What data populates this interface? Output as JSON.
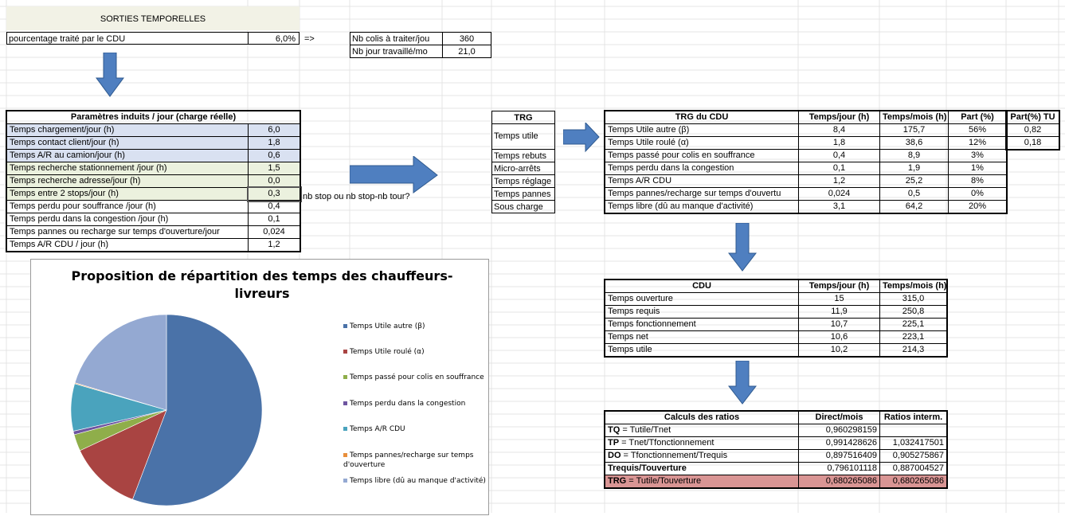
{
  "header": {
    "title": "SORTIES TEMPORELLES"
  },
  "top": {
    "pct_label": "pourcentage traité par le CDU",
    "pct_value": "6,0%",
    "arrow_text": "=>",
    "colis_label": "Nb colis à traiter/jou",
    "colis_value": "360",
    "jours_label": "Nb jour travaillé/mo",
    "jours_value": "21,0"
  },
  "params": {
    "title": "Paramètres induits / jour (charge réelle)",
    "rows": [
      {
        "label": "Temps chargement/jour (h)",
        "value": "6,0"
      },
      {
        "label": "Temps contact client/jour (h)",
        "value": "1,8"
      },
      {
        "label": "Temps A/R au camion/jour (h)",
        "value": "0,6"
      },
      {
        "label": "Temps recherche stationnement /jour (h)",
        "value": "1,5"
      },
      {
        "label": "Temps recherche adresse/jour (h)",
        "value": "0,0"
      },
      {
        "label": "Temps entre 2 stops/jour (h)",
        "value": "0,3"
      },
      {
        "label": "Temps perdu pour souffrance /jour (h)",
        "value": "0,4"
      },
      {
        "label": "Temps perdu dans la congestion /jour (h)",
        "value": "0,1"
      },
      {
        "label": "Temps pannes ou recharge sur temps d'ouverture/jour",
        "value": "0,024"
      },
      {
        "label": "Temps A/R CDU / jour (h)",
        "value": "1,2"
      }
    ],
    "note": "nb stop ou nb stop-nb tour?"
  },
  "trg_list": {
    "title": "TRG",
    "items": [
      "Temps utile",
      "Temps rebuts",
      "Micro-arrêts",
      "Temps réglage",
      "Temps pannes",
      "Sous charge"
    ]
  },
  "trg_cdu": {
    "headers": [
      "TRG du CDU",
      "Temps/jour (h)",
      "Temps/mois (h)",
      "Part (%)",
      "Part(%) TU"
    ],
    "rows": [
      [
        "Temps Utile autre (β)",
        "8,4",
        "175,7",
        "56%",
        "0,82"
      ],
      [
        "Temps Utile roulé (α)",
        "1,8",
        "38,6",
        "12%",
        "0,18"
      ],
      [
        "Temps passé pour colis en souffrance",
        "0,4",
        "8,9",
        "3%",
        ""
      ],
      [
        "Temps perdu dans la congestion",
        "0,1",
        "1,9",
        "1%",
        ""
      ],
      [
        "Temps A/R CDU",
        "1,2",
        "25,2",
        "8%",
        ""
      ],
      [
        "Temps pannes/recharge sur temps d'ouvertu",
        "0,024",
        "0,5",
        "0%",
        ""
      ],
      [
        "Temps libre (dû au manque d'activité)",
        "3,1",
        "64,2",
        "20%",
        ""
      ]
    ]
  },
  "cdu": {
    "headers": [
      "CDU",
      "Temps/jour (h)",
      "Temps/mois (h)"
    ],
    "rows": [
      [
        "Temps ouverture",
        "15",
        "315,0"
      ],
      [
        "Temps requis",
        "11,9",
        "250,8"
      ],
      [
        "Temps fonctionnement",
        "10,7",
        "225,1"
      ],
      [
        "Temps net",
        "10,6",
        "223,1"
      ],
      [
        "Temps utile",
        "10,2",
        "214,3"
      ]
    ]
  },
  "ratios": {
    "headers": [
      "Calculs des ratios",
      "Direct/mois",
      "Ratios interm."
    ],
    "rows": [
      {
        "bold": "TQ",
        "rest": " = Tutile/Tnet",
        "direct": "0,960298159",
        "interm": ""
      },
      {
        "bold": "TP",
        "rest": " = Tnet/Tfonctionnement",
        "direct": "0,991428626",
        "interm": "1,032417501"
      },
      {
        "bold": "DO",
        "rest": " = Tfonctionnement/Trequis",
        "direct": "0,897516409",
        "interm": "0,905275867"
      },
      {
        "bold": "Trequis/Touverture",
        "rest": "",
        "direct": "0,796101118",
        "interm": "0,887004527"
      },
      {
        "bold": "TRG",
        "rest": " = Tutile/Touverture",
        "direct": "0,680265086",
        "interm": "0,680265086"
      }
    ]
  },
  "chart_data": {
    "type": "pie",
    "title": "Proposition de répartition des temps des chauffeurs-livreurs",
    "categories": [
      "Temps Utile autre (β)",
      "Temps Utile roulé (α)",
      "Temps passé pour colis en souffrance",
      "Temps perdu dans la congestion",
      "Temps A/R CDU",
      "Temps pannes/recharge sur temps d'ouverture",
      "Temps libre (dû au manque d'activité)"
    ],
    "values": [
      175.7,
      38.6,
      8.9,
      1.9,
      25.2,
      0.5,
      64.2
    ],
    "colors": [
      "#4a72a8",
      "#a94442",
      "#8fae4a",
      "#6e55a0",
      "#4aa3bd",
      "#e88f3c",
      "#94a9d2"
    ],
    "legend_position": "right"
  },
  "colors": {
    "header_bg": "#f2f2e6",
    "blue_fill": "#d9e1f1",
    "green_fill": "#ebf1de",
    "trg_highlight": "#d99594",
    "arrow": "#4f7fc0"
  }
}
